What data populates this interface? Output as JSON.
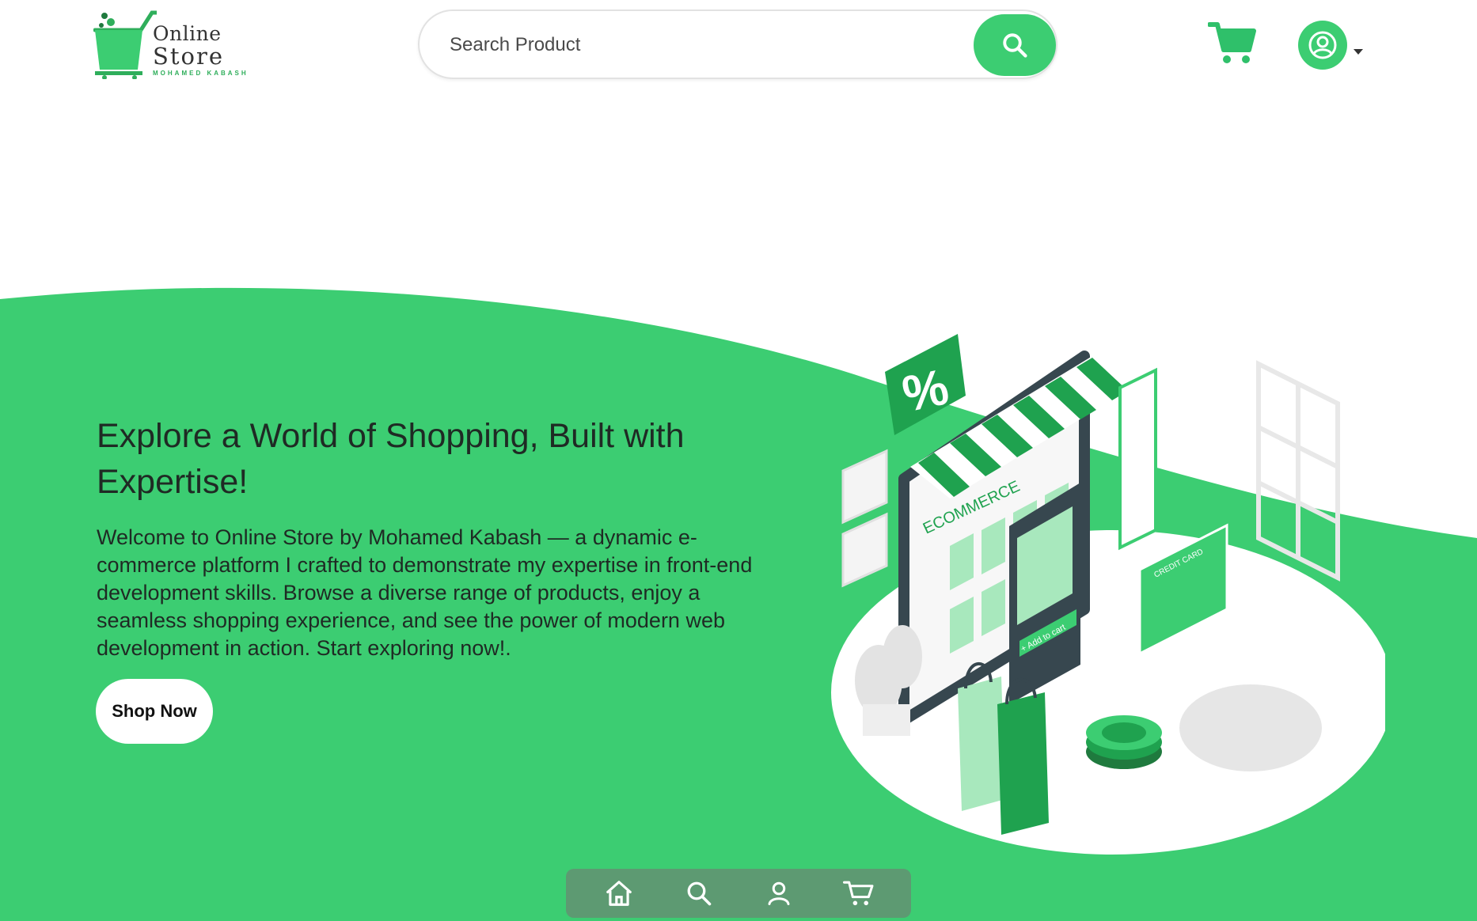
{
  "header": {
    "logo": {
      "line1": "Online",
      "line2": "Store",
      "line3": "MOHAMED KABASH",
      "icon": "shopping-cart-logo-icon"
    },
    "search": {
      "placeholder": "Search Product",
      "value": "",
      "button_icon": "search-icon"
    },
    "cart_icon": "cart-icon",
    "user_icon": "user-circle-icon",
    "user_menu_icon": "caret-down-icon"
  },
  "hero": {
    "title": "Explore a World of Shopping, Built with Expertise!",
    "description": "Welcome to Online Store by Mohamed Kabash — a dynamic e-commerce platform I crafted to demonstrate my expertise in front-end development skills. Browse a diverse range of products, enjoy a seamless shopping experience, and see the power of modern web development in action. Start exploring now!.",
    "cta_label": "Shop Now",
    "illustration": {
      "sign_text": "ECOMMERCE",
      "percent_badge": "%",
      "card_label": "CREDIT CARD",
      "add_to_cart": "+ Add to cart"
    }
  },
  "bottom_nav": {
    "items": [
      {
        "icon": "home-icon"
      },
      {
        "icon": "search-icon"
      },
      {
        "icon": "user-icon"
      },
      {
        "icon": "cart-icon"
      }
    ]
  },
  "colors": {
    "brand_green": "#3ccd72",
    "dark_green": "#1f9e4e",
    "nav_bg": "#5d9a72",
    "text_dark": "#1f2a24"
  }
}
